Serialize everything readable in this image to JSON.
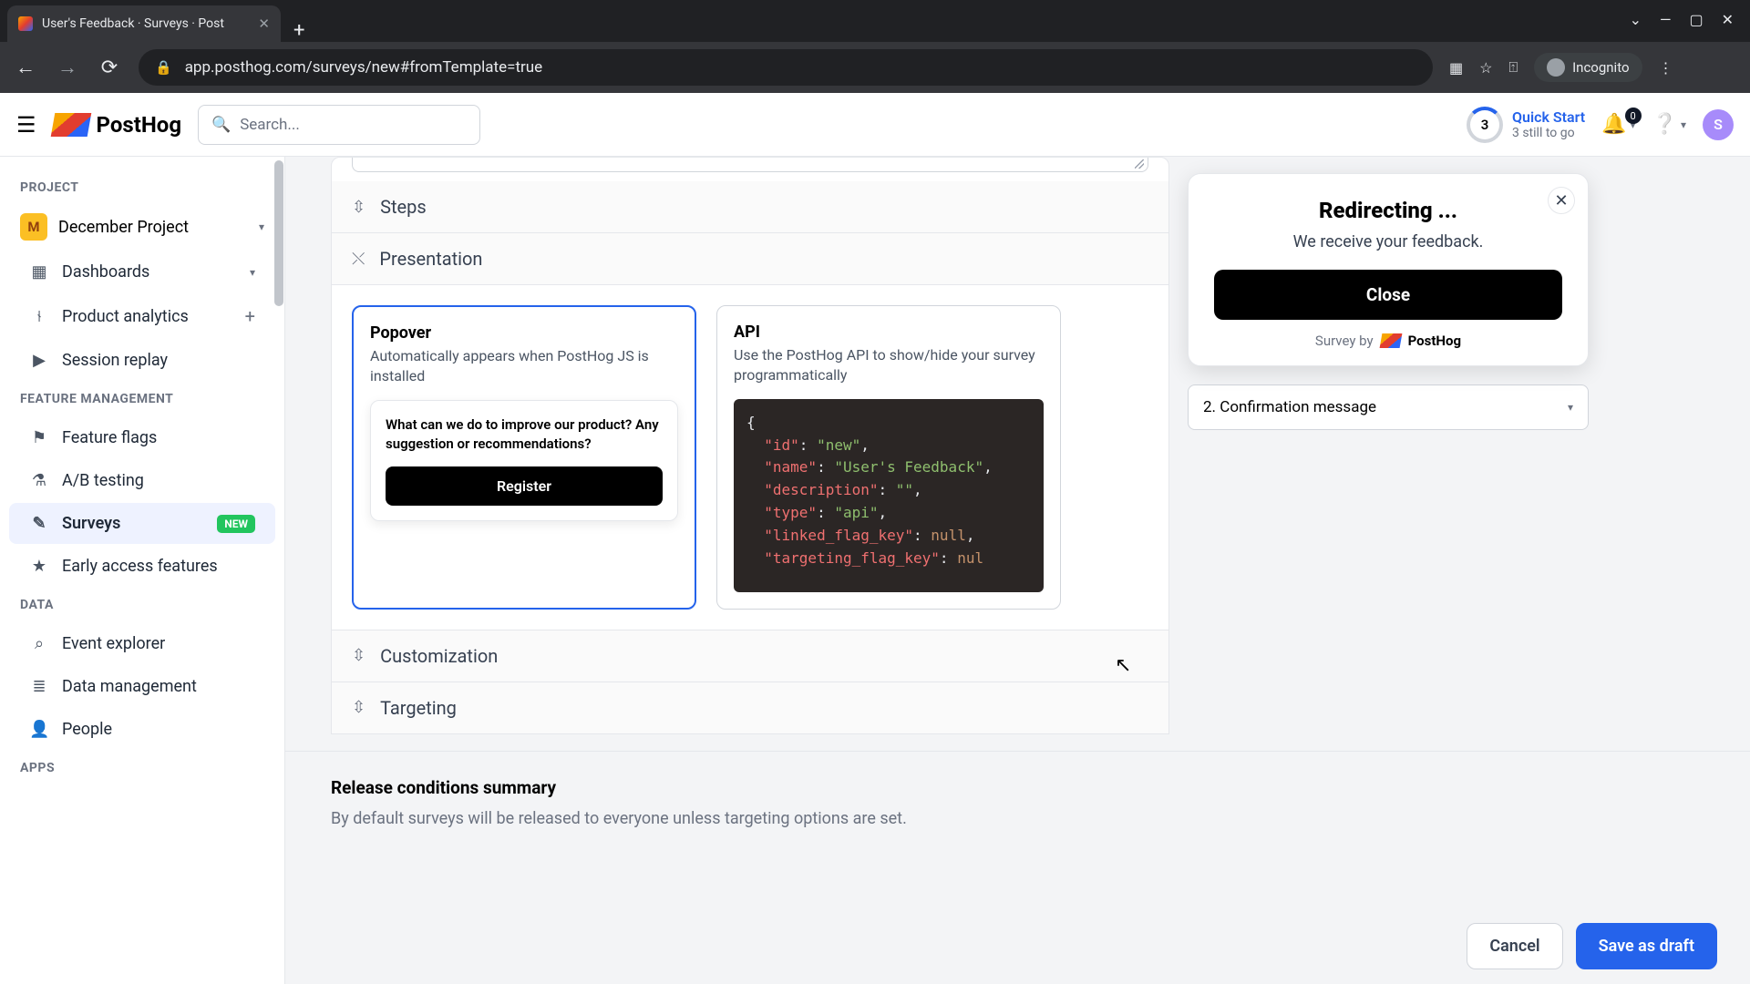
{
  "browser": {
    "tab_title": "User's Feedback · Surveys · Post",
    "url": "app.posthog.com/surveys/new#fromTemplate=true",
    "incognito": "Incognito"
  },
  "header": {
    "brand": "PostHog",
    "search_placeholder": "Search...",
    "quickstart_title": "Quick Start",
    "quickstart_sub": "3 still to go",
    "quickstart_count": "3",
    "notif_count": "0",
    "avatar_letter": "S"
  },
  "sidebar": {
    "section_project": "PROJECT",
    "project_letter": "M",
    "project_name": "December Project",
    "items_main": [
      {
        "icon": "▦",
        "label": "Dashboards",
        "trail": "▾"
      },
      {
        "icon": "⫮",
        "label": "Product analytics",
        "trail": "+"
      },
      {
        "icon": "▶",
        "label": "Session replay",
        "trail": ""
      }
    ],
    "section_feature": "FEATURE MANAGEMENT",
    "items_feature": [
      {
        "icon": "⚑",
        "label": "Feature flags"
      },
      {
        "icon": "⚗",
        "label": "A/B testing"
      },
      {
        "icon": "✎",
        "label": "Surveys",
        "new": "NEW",
        "active": true
      },
      {
        "icon": "★",
        "label": "Early access features"
      }
    ],
    "section_data": "DATA",
    "items_data": [
      {
        "icon": "⌕",
        "label": "Event explorer"
      },
      {
        "icon": "≣",
        "label": "Data management"
      },
      {
        "icon": "👤",
        "label": "People"
      }
    ],
    "section_apps": "APPS"
  },
  "editor": {
    "acc_steps": "Steps",
    "acc_presentation": "Presentation",
    "acc_customization": "Customization",
    "acc_targeting": "Targeting",
    "popover": {
      "title": "Popover",
      "desc": "Automatically appears when PostHog JS is installed",
      "question": "What can we do to improve our product? Any suggestion or recommendations?",
      "btn": "Register"
    },
    "api": {
      "title": "API",
      "desc": "Use the PostHog API to show/hide your survey programmatically",
      "json_id_k": "\"id\"",
      "json_id_v": "\"new\"",
      "json_name_k": "\"name\"",
      "json_name_v": "\"User's Feedback\"",
      "json_desc_k": "\"description\"",
      "json_desc_v": "\"\"",
      "json_type_k": "\"type\"",
      "json_type_v": "\"api\"",
      "json_lfk_k": "\"linked_flag_key\"",
      "json_lfk_v": "null",
      "json_tfk_k": "\"targeting_flag_key\"",
      "json_tfk_v": "nul"
    },
    "release_title": "Release conditions summary",
    "release_desc": "By default surveys will be released to everyone unless targeting options are set.",
    "cancel": "Cancel",
    "save": "Save as draft"
  },
  "preview": {
    "title": "Redirecting ...",
    "sub": "We receive your feedback.",
    "close": "Close",
    "survey_by": "Survey by",
    "brand": "PostHog",
    "conf_dropdown": "2. Confirmation message"
  }
}
